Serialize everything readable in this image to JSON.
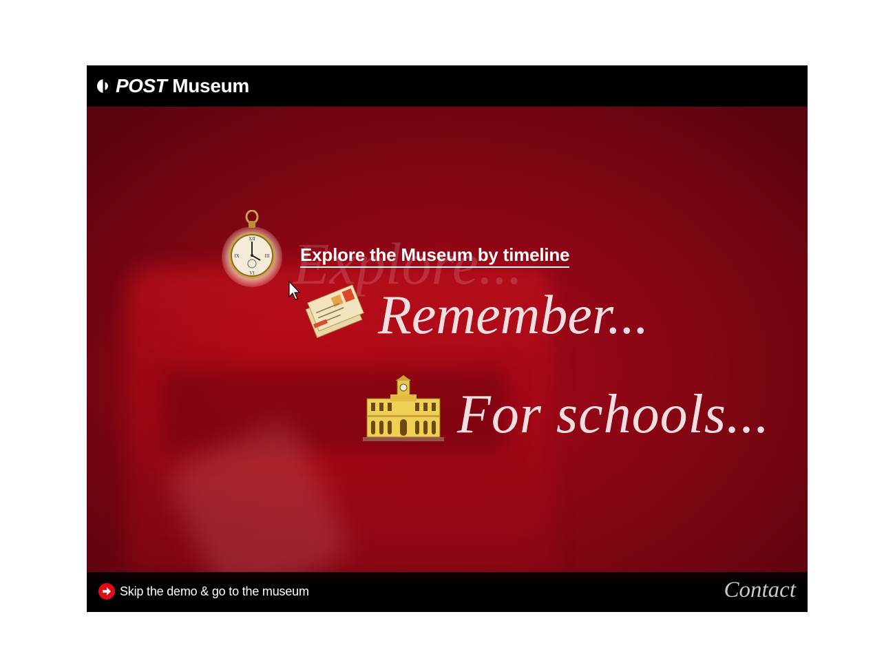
{
  "header": {
    "logo_post": "POST",
    "logo_museum": "Museum"
  },
  "menu": {
    "explore_ghost": "Explore...",
    "explore_link": "Explore the Museum by timeline",
    "remember": "Remember...",
    "schools": "For schools..."
  },
  "footer": {
    "skip_label": "Skip the demo & go to the museum",
    "contact": "Contact"
  },
  "icons": {
    "logo": "australia-post-logo-icon",
    "watch": "pocket-watch-icon",
    "letters": "letters-icon",
    "building": "post-office-building-icon",
    "skip": "arrow-right-icon",
    "cursor": "mouse-cursor-icon"
  },
  "colors": {
    "brand_red": "#e20a16",
    "background_red": "#8a0614",
    "text_light": "#f2dde0"
  }
}
